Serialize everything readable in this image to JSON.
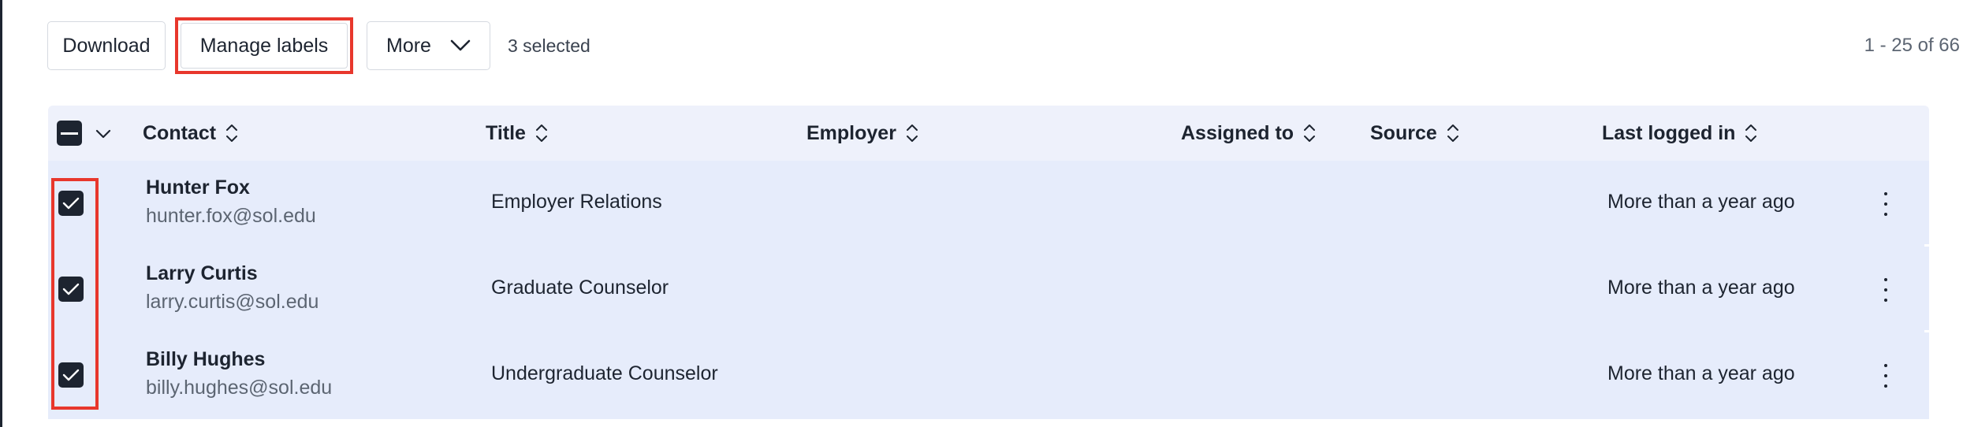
{
  "toolbar": {
    "download_label": "Download",
    "manage_labels_label": "Manage labels",
    "more_label": "More",
    "selected_text": "3 selected"
  },
  "pagination": {
    "text": "1 - 25 of 66"
  },
  "table": {
    "columns": [
      {
        "label": "Contact"
      },
      {
        "label": "Title"
      },
      {
        "label": "Employer"
      },
      {
        "label": "Assigned to"
      },
      {
        "label": "Source"
      },
      {
        "label": "Last logged in"
      }
    ],
    "rows": [
      {
        "selected": true,
        "name": "Hunter Fox",
        "email": "hunter.fox@sol.edu",
        "title": "Employer Relations",
        "employer": "",
        "assigned_to": "",
        "source": "",
        "last_logged_in": "More than a year ago"
      },
      {
        "selected": true,
        "name": "Larry Curtis",
        "email": "larry.curtis@sol.edu",
        "title": "Graduate Counselor",
        "employer": "",
        "assigned_to": "",
        "source": "",
        "last_logged_in": "More than a year ago"
      },
      {
        "selected": true,
        "name": "Billy Hughes",
        "email": "billy.hughes@sol.edu",
        "title": "Undergraduate Counselor",
        "employer": "",
        "assigned_to": "",
        "source": "",
        "last_logged_in": "More than a year ago"
      }
    ]
  },
  "icons": {
    "more_chevron": "chevron-down-icon",
    "sort": "sort-icon",
    "row_menu": "kebab-menu-icon",
    "checkbox": "checkbox-checked-icon"
  },
  "colors": {
    "highlight": "#e8372c",
    "header_bg": "#eef1fb",
    "row_bg": "#e6ecfb",
    "checkbox": "#1d2430"
  }
}
